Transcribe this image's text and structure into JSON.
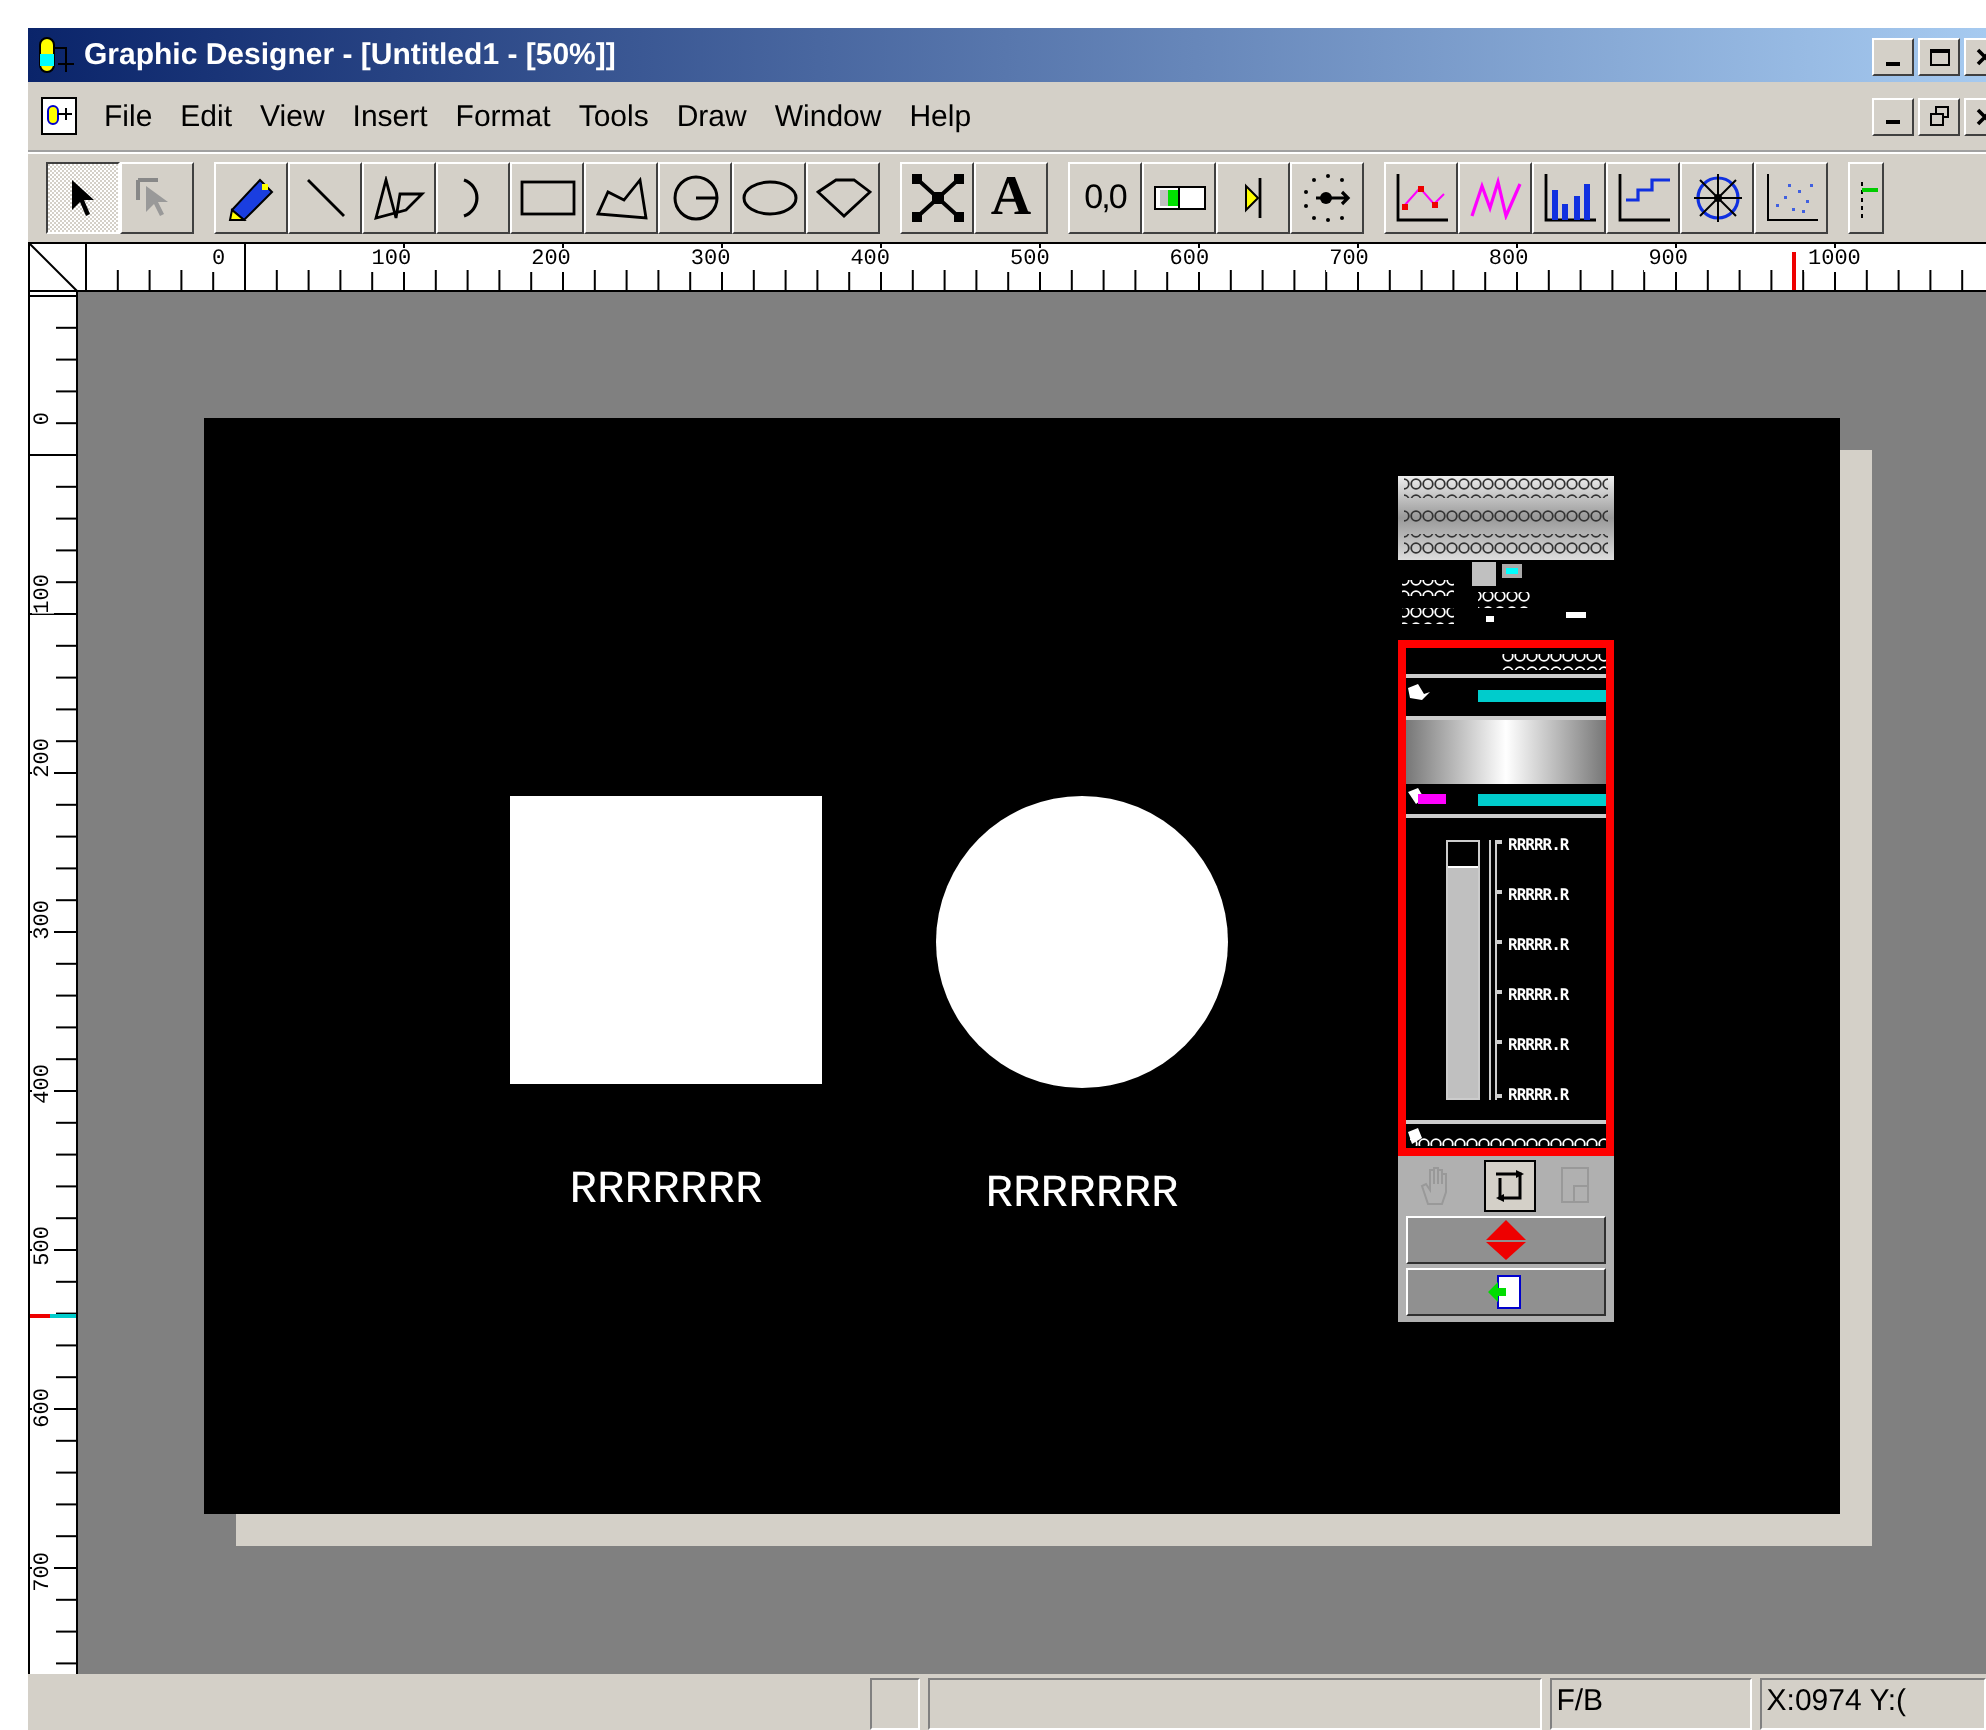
{
  "window": {
    "title": "Graphic Designer - [Untitled1 - [50%]]"
  },
  "menu": [
    "File",
    "Edit",
    "View",
    "Insert",
    "Format",
    "Tools",
    "Draw",
    "Window",
    "Help"
  ],
  "toolbar": [
    [
      {
        "kind": "pointer",
        "selected": true
      },
      {
        "kind": "subselect",
        "selected": false
      }
    ],
    [
      {
        "kind": "pencil",
        "selected": false
      },
      {
        "kind": "line",
        "selected": false
      },
      {
        "kind": "polyline",
        "selected": false
      },
      {
        "kind": "arc",
        "selected": false
      },
      {
        "kind": "rectangle",
        "selected": false
      },
      {
        "kind": "polygon",
        "selected": false
      },
      {
        "kind": "segment",
        "selected": false
      },
      {
        "kind": "ellipse",
        "selected": false
      },
      {
        "kind": "diamond",
        "selected": false
      }
    ],
    [
      {
        "kind": "points",
        "selected": false
      },
      {
        "kind": "text",
        "label": "A",
        "selected": false
      }
    ],
    [
      {
        "kind": "digits",
        "label": "0,0",
        "selected": false
      },
      {
        "kind": "barbox",
        "selected": false
      },
      {
        "kind": "marker",
        "selected": false
      },
      {
        "kind": "dots",
        "selected": false
      }
    ],
    [
      {
        "kind": "linechart",
        "selected": false
      },
      {
        "kind": "trend",
        "selected": false
      },
      {
        "kind": "barchart",
        "selected": false
      },
      {
        "kind": "step",
        "selected": false
      },
      {
        "kind": "radar",
        "selected": false
      },
      {
        "kind": "scatter",
        "selected": false
      }
    ]
  ],
  "ruler_h": [
    "0",
    "100",
    "200",
    "300",
    "400",
    "500",
    "600",
    "700",
    "800",
    "900",
    "1000"
  ],
  "ruler_v": [
    "0",
    "100",
    "200",
    "300",
    "400",
    "500",
    "600",
    "700"
  ],
  "canvas": {
    "shapes": [
      {
        "kind": "rectangle",
        "label": "RRRRRRR"
      },
      {
        "kind": "circle",
        "label": "RRRRRRR"
      }
    ],
    "faceplate": {
      "level": 0.9,
      "scale": [
        "RRRRR.R",
        "RRRRR.R",
        "RRRRR.R",
        "RRRRR.R",
        "RRRRR.R",
        "RRRRR.R"
      ]
    }
  },
  "status_bar": [
    "F/B",
    "X:0974 Y:("
  ]
}
